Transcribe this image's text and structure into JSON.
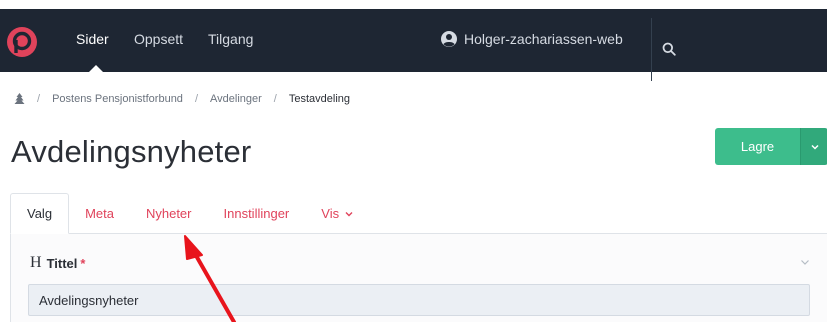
{
  "nav": {
    "items": [
      {
        "label": "Sider"
      },
      {
        "label": "Oppsett"
      },
      {
        "label": "Tilgang"
      }
    ],
    "site_label": "Holger-zachariassen-web",
    "logo_color": "#e0435b",
    "background": "#1e2633"
  },
  "breadcrumb": {
    "items": [
      {
        "label": "Postens Pensjonistforbund"
      },
      {
        "label": "Avdelinger"
      },
      {
        "label": "Testavdeling"
      }
    ],
    "separator": "/"
  },
  "page": {
    "title": "Avdelingsnyheter"
  },
  "toolbar": {
    "save_label": "Lagre",
    "accent": "#3dbd8c"
  },
  "tabs": [
    {
      "label": "Valg"
    },
    {
      "label": "Meta"
    },
    {
      "label": "Nyheter"
    },
    {
      "label": "Innstillinger"
    },
    {
      "label": "Vis"
    }
  ],
  "form": {
    "title_field": {
      "label": "Tittel",
      "required_mark": "*",
      "heading_icon": "H",
      "value": "Avdelingsnyheter"
    }
  },
  "icons": {
    "logo": "brand-p-logo",
    "site": "user-circle-icon",
    "search": "search-icon",
    "home": "tree-home-icon",
    "dropdown": "chevron-down-icon"
  },
  "annotation": {
    "arrow_color": "#e8141c"
  }
}
